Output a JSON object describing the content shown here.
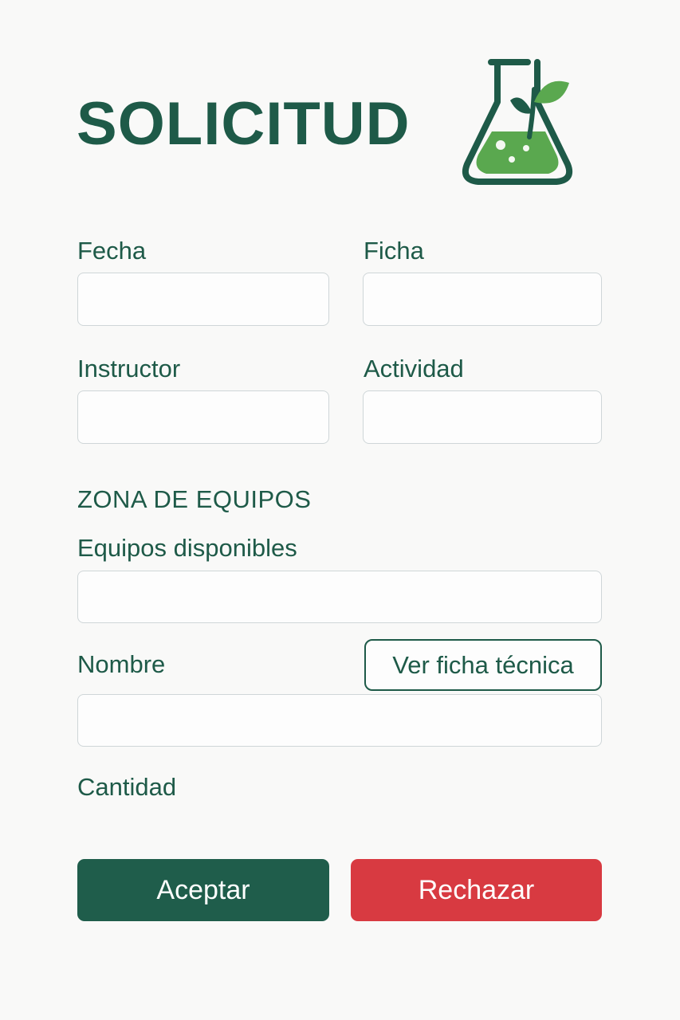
{
  "header": {
    "title": "SOLICITUD",
    "logo_icon": "lab-flask-leaf-icon"
  },
  "form": {
    "fecha": {
      "label": "Fecha",
      "value": "",
      "placeholder": ""
    },
    "ficha": {
      "label": "Ficha",
      "value": "",
      "placeholder": ""
    },
    "instructor": {
      "label": "Instructor",
      "value": "",
      "placeholder": ""
    },
    "actividad": {
      "label": "Actividad",
      "value": "",
      "placeholder": ""
    }
  },
  "equipment": {
    "section_title": "ZONA DE EQUIPOS",
    "available": {
      "label": "Equipos disponibles",
      "value": "",
      "placeholder": ""
    },
    "nombre": {
      "label": "Nombre",
      "value": "",
      "placeholder": ""
    },
    "tech_sheet_button": "Ver ficha técnica",
    "cantidad": {
      "label": "Cantidad"
    }
  },
  "actions": {
    "accept_label": "Aceptar",
    "reject_label": "Rechazar"
  },
  "colors": {
    "primary": "#1f5d4b",
    "danger": "#d83a41",
    "accent_green": "#5aa84f",
    "background": "#f9f9f8",
    "field_border": "#cfd6d8"
  }
}
